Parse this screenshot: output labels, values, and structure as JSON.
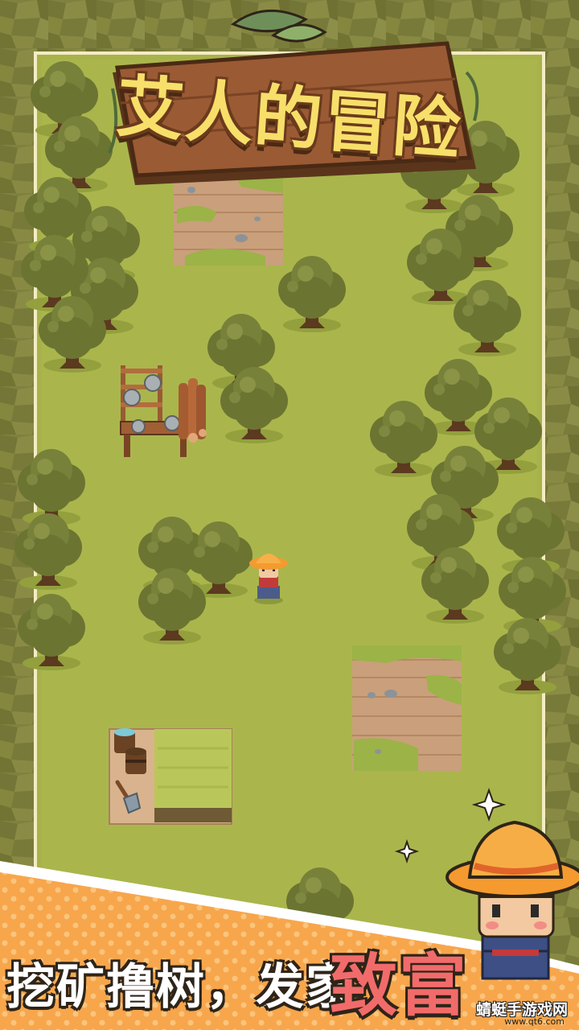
{
  "game": {
    "title": "艾人的冒险",
    "slogan_main": "挖矿撸树，发家",
    "slogan_accent": "致富"
  },
  "watermark": {
    "text": "蜻蜓手游戏网",
    "url": "www.qt6.com"
  },
  "colors": {
    "grass": "#a7b34a",
    "tree_canopy": "#6c7432",
    "dirt": "#c9a07b",
    "wood": "#9a5a34",
    "border_bg": "#7d7f3e",
    "banner_orange": "#f7a64c",
    "slogan_accent": "#f26b6b"
  },
  "icons": [
    "tree-icon",
    "sawmill-icon",
    "log-pile-icon",
    "water-bucket-icon",
    "shovel-icon",
    "farmer-icon",
    "sparkle-icon"
  ]
}
